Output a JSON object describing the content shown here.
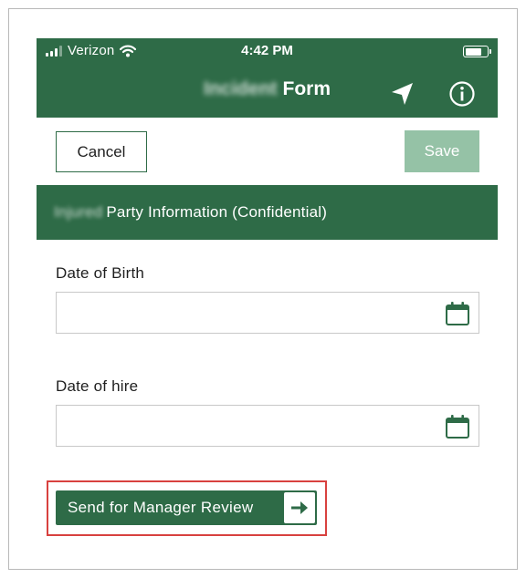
{
  "status_bar": {
    "carrier": "Verizon",
    "time": "4:42 PM",
    "signal_bars": 4,
    "signal_active": 3,
    "battery_level": 0.8
  },
  "header": {
    "title_blurred": "Incident",
    "title": "Form",
    "icons": [
      "location-arrow-icon",
      "info-icon"
    ]
  },
  "toolbar": {
    "cancel_label": "Cancel",
    "save_label": "Save"
  },
  "section": {
    "title_blurred": "Injured",
    "title": "Party Information (Confidential)"
  },
  "fields": [
    {
      "label": "Date of Birth",
      "value": "",
      "icon": "calendar-icon"
    },
    {
      "label": "Date of hire",
      "value": "",
      "icon": "calendar-icon"
    }
  ],
  "send_button": {
    "label": "Send for Manager Review",
    "icon": "arrow-right-icon"
  },
  "colors": {
    "brand_green": "#2e6b47",
    "save_disabled": "#95c2a6",
    "highlight_red": "#d8413f"
  }
}
